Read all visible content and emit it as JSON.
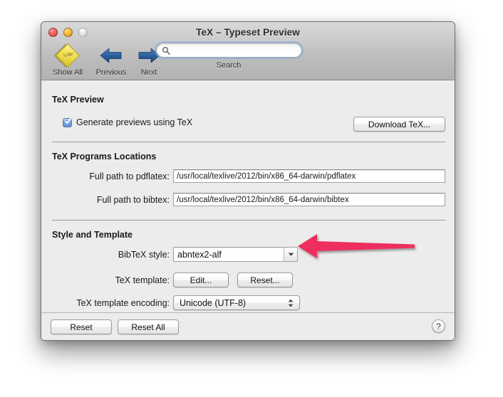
{
  "window": {
    "title": "TeX – Typeset Preview",
    "controls": {
      "close": "close-button",
      "minimize": "minimize-button",
      "zoom": "zoom-button"
    }
  },
  "toolbar": {
    "items": [
      {
        "label": "Show All",
        "icon": "diamond-cite-icon"
      },
      {
        "label": "Previous",
        "icon": "left-arrow-icon"
      },
      {
        "label": "Next",
        "icon": "right-arrow-icon"
      }
    ],
    "search": {
      "label": "Search",
      "value": "",
      "placeholder": "",
      "icon": "search-icon"
    }
  },
  "sections": [
    {
      "title": "TeX Preview",
      "checkbox": {
        "label": "Generate previews using TeX",
        "checked": true
      },
      "button": "Download TeX..."
    },
    {
      "title": "TeX Programs Locations",
      "fields": [
        {
          "label": "Full path to pdflatex:",
          "value": "/usr/local/texlive/2012/bin/x86_64-darwin/pdflatex"
        },
        {
          "label": "Full path to bibtex:",
          "value": "/usr/local/texlive/2012/bin/x86_64-darwin/bibtex"
        }
      ]
    },
    {
      "title": "Style and Template",
      "bibtex_style": {
        "label": "BibTeX style:",
        "value": "abntex2-alf"
      },
      "template": {
        "label": "TeX template:",
        "edit_button": "Edit...",
        "reset_button": "Reset..."
      },
      "encoding": {
        "label": "TeX template encoding:",
        "value": "Unicode (UTF-8)"
      }
    }
  ],
  "footer": {
    "reset": "Reset",
    "reset_all": "Reset All",
    "help": "?"
  },
  "annotation": {
    "type": "arrow",
    "direction": "left",
    "target": "bibtex-style-combo",
    "color": "#ee2d5e"
  }
}
